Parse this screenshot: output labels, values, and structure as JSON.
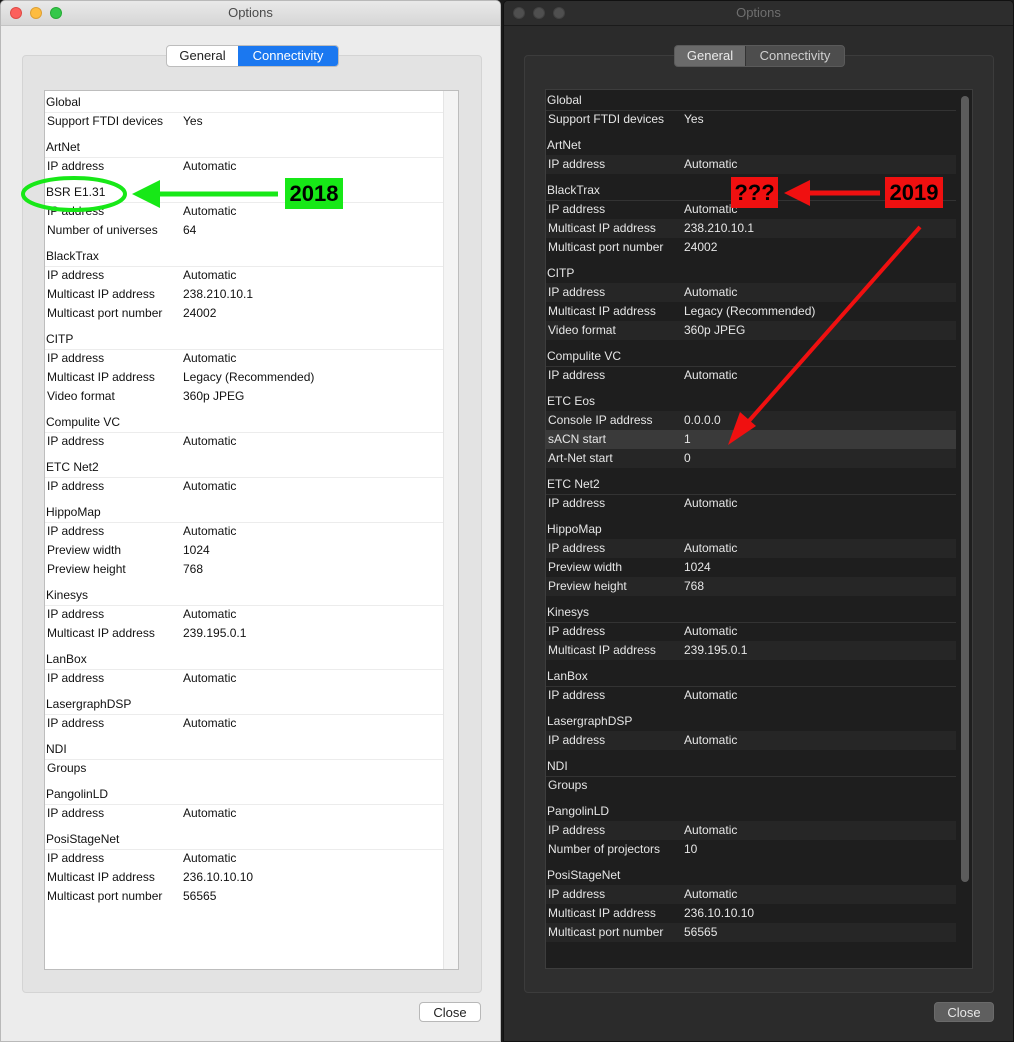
{
  "colors": {
    "light_tab_selected": "#1b78f0",
    "annotation_green": "#17e817",
    "annotation_red": "#f01010"
  },
  "light_window": {
    "title": "Options",
    "tabs": {
      "general": "General",
      "connectivity": "Connectivity",
      "selected": "Connectivity"
    },
    "rows": [
      {
        "t": "section",
        "k": "Global"
      },
      {
        "t": "prop",
        "k": "Support FTDI devices",
        "v": "Yes"
      },
      {
        "t": "section",
        "k": "ArtNet"
      },
      {
        "t": "prop",
        "k": "IP address",
        "v": "Automatic"
      },
      {
        "t": "section",
        "k": "BSR E1.31"
      },
      {
        "t": "prop",
        "k": "IP address",
        "v": "Automatic"
      },
      {
        "t": "prop",
        "k": "Number of universes",
        "v": "64"
      },
      {
        "t": "section",
        "k": "BlackTrax"
      },
      {
        "t": "prop",
        "k": "IP address",
        "v": "Automatic"
      },
      {
        "t": "prop",
        "k": "Multicast IP address",
        "v": "238.210.10.1"
      },
      {
        "t": "prop",
        "k": "Multicast port number",
        "v": "24002"
      },
      {
        "t": "section",
        "k": "CITP"
      },
      {
        "t": "prop",
        "k": "IP address",
        "v": "Automatic"
      },
      {
        "t": "prop",
        "k": "Multicast IP address",
        "v": "Legacy (Recommended)"
      },
      {
        "t": "prop",
        "k": "Video format",
        "v": "360p JPEG"
      },
      {
        "t": "section",
        "k": "Compulite VC"
      },
      {
        "t": "prop",
        "k": "IP address",
        "v": "Automatic"
      },
      {
        "t": "section",
        "k": "ETC Net2"
      },
      {
        "t": "prop",
        "k": "IP address",
        "v": "Automatic"
      },
      {
        "t": "section",
        "k": "HippoMap"
      },
      {
        "t": "prop",
        "k": "IP address",
        "v": "Automatic"
      },
      {
        "t": "prop",
        "k": "Preview width",
        "v": "1024"
      },
      {
        "t": "prop",
        "k": "Preview height",
        "v": "768"
      },
      {
        "t": "section",
        "k": "Kinesys"
      },
      {
        "t": "prop",
        "k": "IP address",
        "v": "Automatic"
      },
      {
        "t": "prop",
        "k": "Multicast IP address",
        "v": "239.195.0.1"
      },
      {
        "t": "section",
        "k": "LanBox"
      },
      {
        "t": "prop",
        "k": "IP address",
        "v": "Automatic"
      },
      {
        "t": "section",
        "k": "LasergraphDSP"
      },
      {
        "t": "prop",
        "k": "IP address",
        "v": "Automatic"
      },
      {
        "t": "section",
        "k": "NDI"
      },
      {
        "t": "prop",
        "k": "Groups",
        "v": ""
      },
      {
        "t": "section",
        "k": "PangolinLD"
      },
      {
        "t": "prop",
        "k": "IP address",
        "v": "Automatic"
      },
      {
        "t": "section",
        "k": "PosiStageNet"
      },
      {
        "t": "prop",
        "k": "IP address",
        "v": "Automatic"
      },
      {
        "t": "prop",
        "k": "Multicast IP address",
        "v": "236.10.10.10"
      },
      {
        "t": "prop",
        "k": "Multicast port number",
        "v": "56565"
      }
    ],
    "close_label": "Close"
  },
  "dark_window": {
    "title": "Options",
    "tabs": {
      "general": "General",
      "connectivity": "Connectivity",
      "selected": "General"
    },
    "rows": [
      {
        "t": "section",
        "k": "Global"
      },
      {
        "t": "prop",
        "k": "Support FTDI devices",
        "v": "Yes"
      },
      {
        "t": "section",
        "k": "ArtNet"
      },
      {
        "t": "prop",
        "k": "IP address",
        "v": "Automatic"
      },
      {
        "t": "section",
        "k": "BlackTrax"
      },
      {
        "t": "prop",
        "k": "IP address",
        "v": "Automatic"
      },
      {
        "t": "prop",
        "k": "Multicast IP address",
        "v": "238.210.10.1"
      },
      {
        "t": "prop",
        "k": "Multicast port number",
        "v": "24002"
      },
      {
        "t": "section",
        "k": "CITP"
      },
      {
        "t": "prop",
        "k": "IP address",
        "v": "Automatic"
      },
      {
        "t": "prop",
        "k": "Multicast IP address",
        "v": "Legacy (Recommended)"
      },
      {
        "t": "prop",
        "k": "Video format",
        "v": "360p JPEG"
      },
      {
        "t": "section",
        "k": "Compulite VC"
      },
      {
        "t": "prop",
        "k": "IP address",
        "v": "Automatic"
      },
      {
        "t": "section",
        "k": "ETC Eos"
      },
      {
        "t": "prop",
        "k": "Console IP address",
        "v": "0.0.0.0"
      },
      {
        "t": "prop",
        "k": "sACN start",
        "v": "1"
      },
      {
        "t": "prop",
        "k": "Art-Net start",
        "v": "0"
      },
      {
        "t": "section",
        "k": "ETC Net2"
      },
      {
        "t": "prop",
        "k": "IP address",
        "v": "Automatic"
      },
      {
        "t": "section",
        "k": "HippoMap"
      },
      {
        "t": "prop",
        "k": "IP address",
        "v": "Automatic"
      },
      {
        "t": "prop",
        "k": "Preview width",
        "v": "1024"
      },
      {
        "t": "prop",
        "k": "Preview height",
        "v": "768"
      },
      {
        "t": "section",
        "k": "Kinesys"
      },
      {
        "t": "prop",
        "k": "IP address",
        "v": "Automatic"
      },
      {
        "t": "prop",
        "k": "Multicast IP address",
        "v": "239.195.0.1"
      },
      {
        "t": "section",
        "k": "LanBox"
      },
      {
        "t": "prop",
        "k": "IP address",
        "v": "Automatic"
      },
      {
        "t": "section",
        "k": "LasergraphDSP"
      },
      {
        "t": "prop",
        "k": "IP address",
        "v": "Automatic"
      },
      {
        "t": "section",
        "k": "NDI"
      },
      {
        "t": "prop",
        "k": "Groups",
        "v": ""
      },
      {
        "t": "section",
        "k": "PangolinLD"
      },
      {
        "t": "prop",
        "k": "IP address",
        "v": "Automatic"
      },
      {
        "t": "prop",
        "k": "Number of projectors",
        "v": "10"
      },
      {
        "t": "section",
        "k": "PosiStageNet"
      },
      {
        "t": "prop",
        "k": "IP address",
        "v": "Automatic"
      },
      {
        "t": "prop",
        "k": "Multicast IP address",
        "v": "236.10.10.10"
      },
      {
        "t": "prop",
        "k": "Multicast port number",
        "v": "56565"
      }
    ],
    "close_label": "Close"
  },
  "annotations": {
    "label_2018": "2018",
    "label_2019": "2019",
    "label_unknown": "???"
  }
}
